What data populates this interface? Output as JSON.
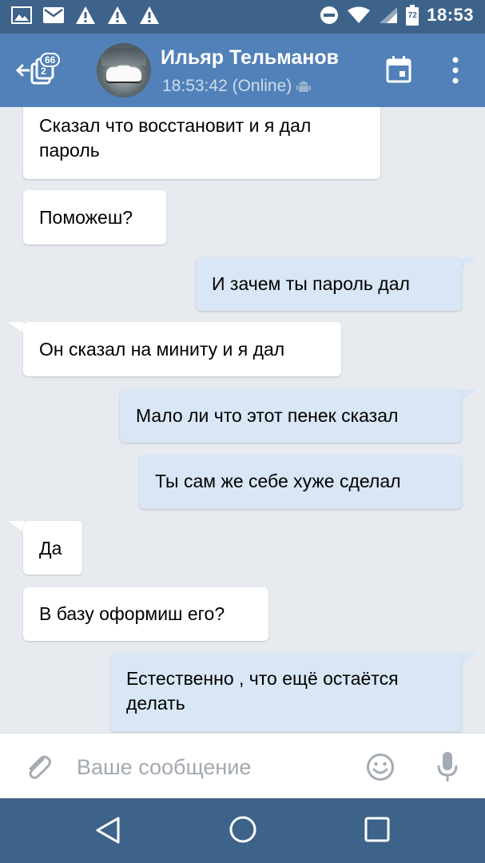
{
  "status_bar": {
    "time": "18:53",
    "battery_level": "72",
    "icons": [
      "image-icon",
      "mail-icon",
      "warning-icon",
      "warning-icon",
      "warning-icon",
      "do-not-disturb-icon",
      "wifi-icon",
      "signal-icon",
      "battery-icon"
    ]
  },
  "header": {
    "unread_badge": "66",
    "contact_name": "Ильяр Тельманов",
    "last_seen": "18:53:42 (Online)",
    "icons": [
      "back-icon",
      "calendar-icon",
      "more-vert-icon",
      "android-icon"
    ]
  },
  "messages": [
    {
      "direction": "in",
      "text_lines": [
        "Сказал что восстановит и я дал",
        "пароль"
      ]
    },
    {
      "direction": "in",
      "text_lines": [
        "Поможеш?"
      ]
    },
    {
      "direction": "out",
      "text_lines": [
        "И зачем ты пароль дал"
      ]
    },
    {
      "direction": "in",
      "text_lines": [
        "Он сказал на миниту и я дал"
      ]
    },
    {
      "direction": "out",
      "text_lines": [
        "Мало ли что этот пенек сказал"
      ]
    },
    {
      "direction": "out",
      "text_lines": [
        "Ты сам же себе хуже сделал"
      ]
    },
    {
      "direction": "in",
      "text_lines": [
        "Да"
      ]
    },
    {
      "direction": "in",
      "text_lines": [
        "В базу оформиш его?"
      ]
    },
    {
      "direction": "out",
      "text_lines": [
        "Естественно , что ещё остаётся",
        "делать"
      ]
    }
  ],
  "composer": {
    "placeholder": "Ваше сообщение",
    "icons": [
      "attach-icon",
      "emoji-icon",
      "mic-icon"
    ]
  },
  "colors": {
    "header_bg": "#5181b8",
    "statusbar_bg": "#3e638a",
    "chat_bg": "#e7ebf0",
    "incoming_bubble": "#ffffff",
    "outgoing_bubble": "#d9e6f5"
  }
}
